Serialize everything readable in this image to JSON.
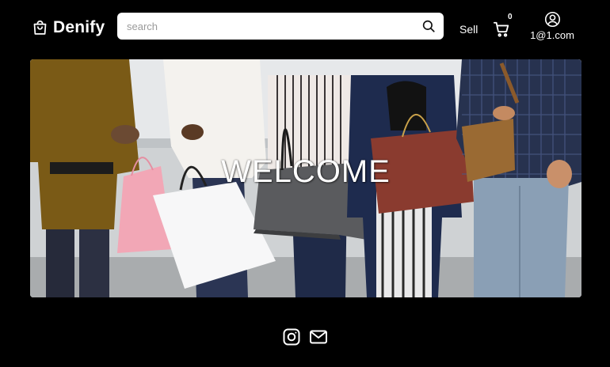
{
  "header": {
    "brand": "Denify",
    "search": {
      "placeholder": "search",
      "value": ""
    },
    "sell_label": "Sell",
    "cart_count": "0",
    "user_email": "1@1.com"
  },
  "hero": {
    "title": "WELCOME"
  },
  "icons": {
    "brand": "shopping-bag-icon",
    "search": "magnifier-icon",
    "cart": "shopping-cart-icon",
    "user": "user-circle-icon",
    "footer": [
      "instagram-icon",
      "mail-icon"
    ]
  },
  "colors": {
    "background": "#000000",
    "search_bg": "#ffffff",
    "text": "#ffffff"
  }
}
